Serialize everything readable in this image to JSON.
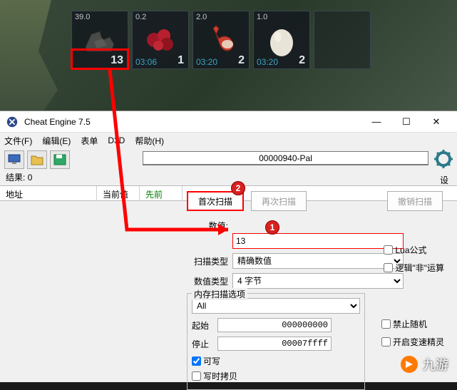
{
  "inventory": {
    "slots": [
      {
        "weight": "39.0",
        "count": "13",
        "timer": ""
      },
      {
        "weight": "0.2",
        "count": "1",
        "timer": "03:06"
      },
      {
        "weight": "2.0",
        "count": "2",
        "timer": "03:20"
      },
      {
        "weight": "1.0",
        "count": "2",
        "timer": "03:20"
      }
    ]
  },
  "window": {
    "title": "Cheat Engine 7.5",
    "min": "—",
    "max": "☐",
    "close": "✕"
  },
  "menu": {
    "file": "文件(F)",
    "edit": "编辑(E)",
    "table": "表单",
    "d3d": "D3D",
    "help": "帮助(H)"
  },
  "process": "00000940-Pal",
  "results": {
    "label": "结果:",
    "count": "0"
  },
  "settings_link": "设",
  "columns": {
    "address": "地址",
    "current": "当前值",
    "previous": "先前"
  },
  "scan": {
    "first": "首次扫描",
    "next": "再次扫描",
    "undo": "撤销扫描",
    "value_label": "数值:",
    "value": "13",
    "scan_type_label": "扫描类型",
    "scan_type": "精确数值",
    "value_type_label": "数值类型",
    "value_type": "4 字节",
    "lua": "Lua公式",
    "not_op": "逻辑\"非\"运算",
    "mem_group": "内存扫描选项",
    "range": "All",
    "start_label": "起始",
    "start": "000000000",
    "stop_label": "停止",
    "stop": "00007ffff",
    "writable": "可写",
    "cow": "写时拷贝",
    "no_random": "禁止随机",
    "speedhack": "开启变速精灵"
  },
  "badges": {
    "one": "1",
    "two": "2"
  },
  "watermark": "九游"
}
